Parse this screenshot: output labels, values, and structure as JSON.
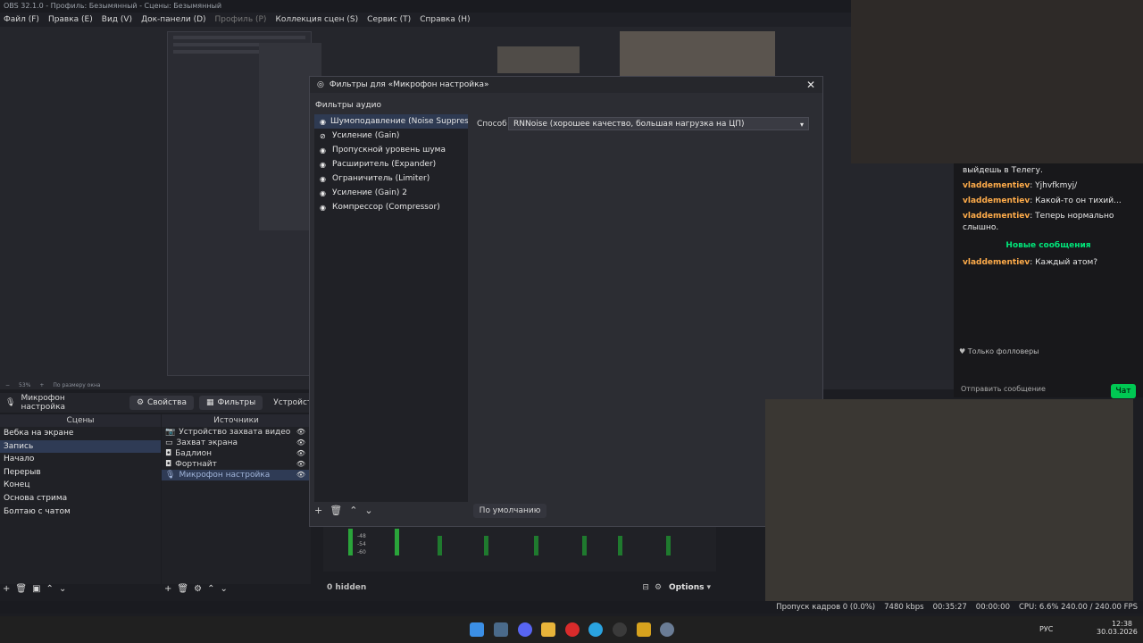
{
  "app": {
    "title": "OBS 32.1.0 - Профиль: Безымянный - Сцены: Безымянный",
    "menu": [
      "Файл (F)",
      "Правка (E)",
      "Вид (V)",
      "Док-панели (D)",
      "Профиль (P)",
      "Коллекция сцен (S)",
      "Сервис (T)",
      "Справка (H)"
    ]
  },
  "zoom": {
    "value": "53%",
    "mode": "По размеру окна"
  },
  "source_toolbar": {
    "source_name": "Микрофон настройка",
    "properties": "Свойства",
    "filters": "Фильтры",
    "device": "Устройство"
  },
  "scenes": {
    "header": "Сцены",
    "items": [
      "Вебка на экране",
      "Запись",
      "Начало",
      "Перерыв",
      "Конец",
      "Основа стрима",
      "Болтаю с чатом"
    ],
    "selected_index": 1
  },
  "sources": {
    "header": "Источники",
    "items": [
      "Устройство захвата видео",
      "Захват экрана",
      "Бадлион",
      "Фортнайт",
      "Микрофон настройка"
    ],
    "selected_index": 4
  },
  "dialog": {
    "title": "Фильтры для «Микрофон настройка»",
    "section": "Фильтры аудио",
    "filters": [
      "Шумоподавление (Noise Suppressio",
      "Усиление (Gain)",
      "Пропускной уровень шума",
      "Расширитель (Expander)",
      "Ограничитель (Limiter)",
      "Усиление (Gain) 2",
      "Компрессор (Compressor)"
    ],
    "method_label": "Способ",
    "method_value": "RNNoise (хорошее качество, большая нагрузка на ЦП)",
    "defaults_button": "По умолчанию"
  },
  "mixer": {
    "hidden": "0 hidden",
    "options": "Options",
    "scale": [
      "-48",
      "-54",
      "-60"
    ]
  },
  "status": {
    "dropped": "Пропуск кадров 0 (0.0%)",
    "bitrate": "7480 kbps",
    "time": "00:35:27",
    "rec_time": "00:00:00",
    "cpu": "CPU: 6.6% 240.00 / 240.00 FPS"
  },
  "chat": {
    "messages": [
      {
        "user": "",
        "text": "выйдешь в Телегу."
      },
      {
        "user": "vladdementiev",
        "text": "Yjhvfkmyj/"
      },
      {
        "user": "vladdementiev",
        "text": "Какой-то он тихий..."
      },
      {
        "user": "vladdementiev",
        "text": "Теперь нормально слышно."
      }
    ],
    "new_messages": "Новые сообщения",
    "after": [
      {
        "user": "vladdementiev",
        "text": "Каждый атом?"
      }
    ],
    "followers_only": "Только фолловеры",
    "send_placeholder": "Отправить сообщение",
    "chat_button": "Чат"
  },
  "taskbar": {
    "lang": "РУС",
    "time": "12:38",
    "date": "30.03.2026"
  }
}
